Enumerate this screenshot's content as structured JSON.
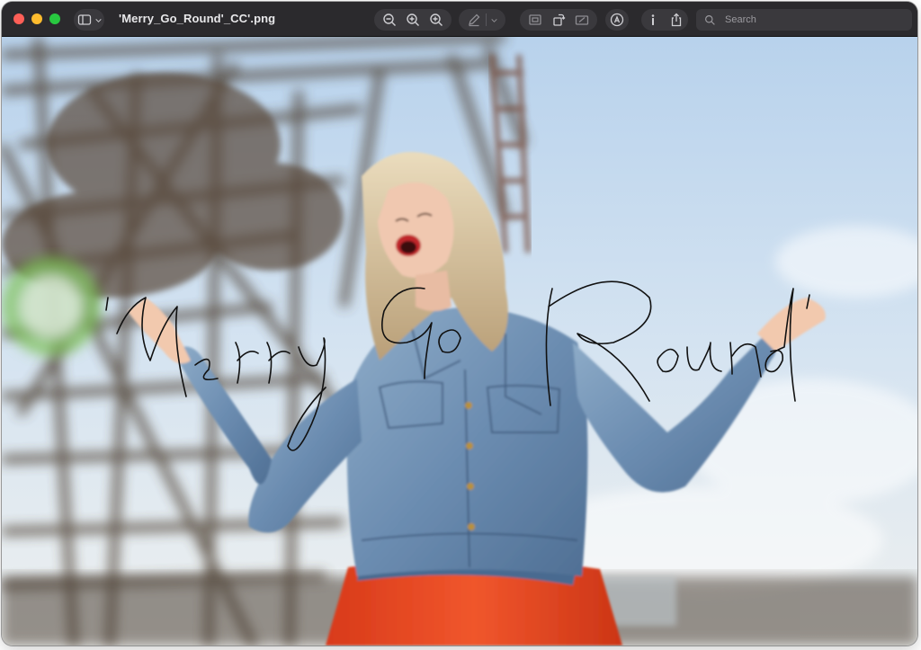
{
  "window": {
    "title": "'Merry_Go_Round'_CC'.png"
  },
  "toolbar": {
    "search_placeholder": "Search",
    "icons": {
      "sidebar": "sidebar-icon",
      "zoom_out": "zoom-out-icon",
      "zoom_actual": "zoom-actual-size-icon",
      "zoom_in": "zoom-in-icon",
      "markup": "pencil-icon",
      "markup_menu": "chevron-down-icon",
      "crop": "crop-icon",
      "rotate": "rotate-icon",
      "form": "form-fill-icon",
      "annotate": "markup-circle-icon",
      "info": "info-icon",
      "share": "share-icon"
    }
  },
  "image": {
    "overlay_text": "'Merry Go Round'",
    "colors": {
      "sky": "#c9dcef",
      "denim": "#6f8fb2",
      "skirt": "#e4421e",
      "hair": "#d9c39a",
      "ride_structure": "#5b4a3c"
    }
  }
}
